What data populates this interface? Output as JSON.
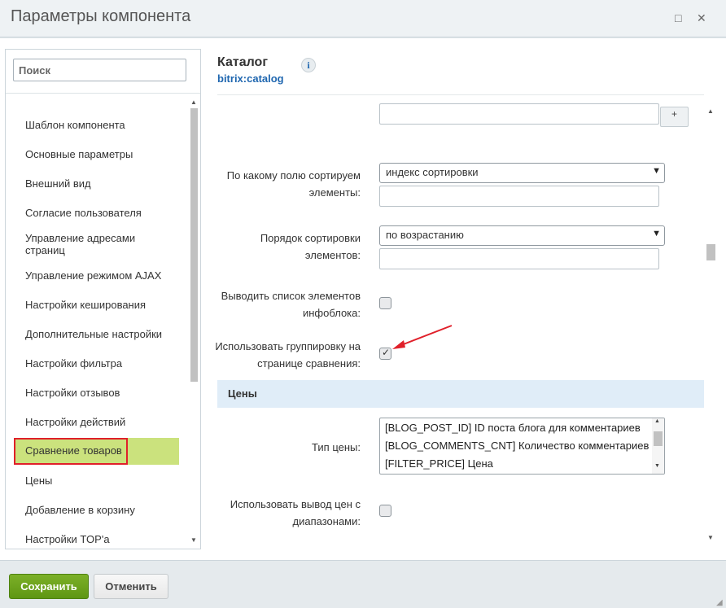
{
  "dialog": {
    "title": "Параметры компонента",
    "minimize_icon": "□",
    "close_icon": "✕"
  },
  "sidebar": {
    "search_placeholder": "Поиск",
    "items": [
      {
        "label": "Шаблон компонента"
      },
      {
        "label": "Основные параметры"
      },
      {
        "label": "Внешний вид"
      },
      {
        "label": "Согласие пользователя"
      },
      {
        "label": "Управление адресами страниц"
      },
      {
        "label": "Управление режимом AJAX"
      },
      {
        "label": "Настройки кеширования"
      },
      {
        "label": "Дополнительные настройки"
      },
      {
        "label": "Настройки фильтра"
      },
      {
        "label": "Настройки отзывов"
      },
      {
        "label": "Настройки действий"
      },
      {
        "label": "Сравнение товаров",
        "active": true
      },
      {
        "label": "Цены"
      },
      {
        "label": "Добавление в корзину"
      },
      {
        "label": "Настройки TOP'а"
      }
    ]
  },
  "component": {
    "title": "Каталог",
    "code": "bitrix:catalog",
    "info_icon": "i"
  },
  "form": {
    "plus_label": "+",
    "sort_field": {
      "label": "По какому полю сортируем элементы:",
      "value": "индекс сортировки"
    },
    "sort_order": {
      "label": "Порядок сортировки элементов:",
      "value": "по возрастанию"
    },
    "show_list": {
      "label": "Выводить список элементов инфоблока:",
      "checked": false
    },
    "use_grouping": {
      "label": "Использовать группировку на странице сравнения:",
      "checked": true
    },
    "prices_section": "Цены",
    "price_type": {
      "label": "Тип цены:",
      "options": [
        "[BLOG_POST_ID] ID поста блога для комментариев",
        "[BLOG_COMMENTS_CNT] Количество комментариев",
        "[FILTER_PRICE] Цена"
      ]
    },
    "price_ranges": {
      "label": "Использовать вывод цен с диапазонами:",
      "checked": false
    }
  },
  "footer": {
    "save_label": "Сохранить",
    "cancel_label": "Отменить"
  },
  "colors": {
    "save_button": "#6aa11c",
    "active_item": "#cbe27d",
    "highlight_border": "#e0202a",
    "arrow": "#e0202a",
    "section_bg": "#e0edf8"
  }
}
